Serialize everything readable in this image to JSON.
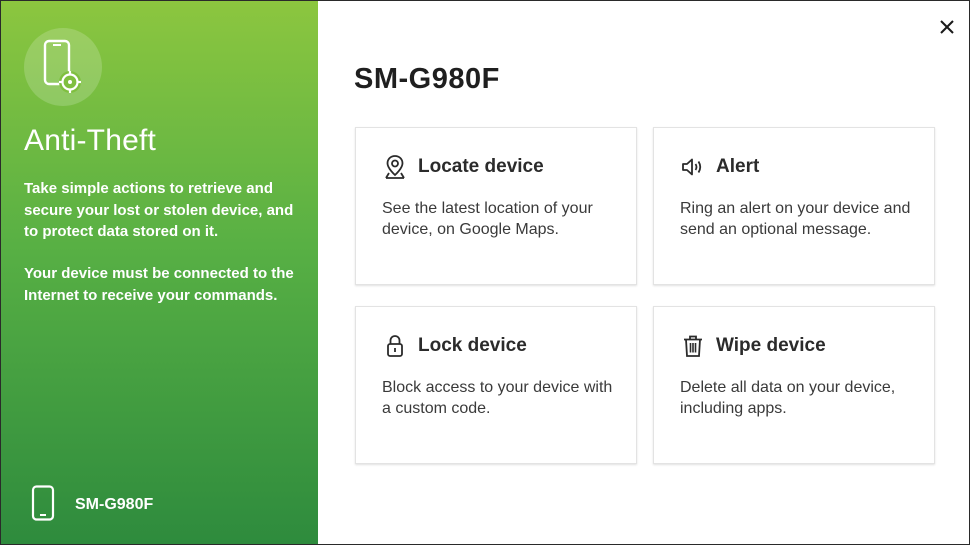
{
  "sidebar": {
    "title": "Anti-Theft",
    "paragraph1": "Take simple actions to retrieve and secure your lost or stolen device, and to protect data stored on it.",
    "paragraph2": "Your device must be connected to the Internet to receive your commands.",
    "device_label": "SM-G980F",
    "hero_icon": "phone-locate-icon",
    "footer_icon": "phone-icon",
    "gradient_top": "#8cc63f",
    "gradient_bottom": "#2e8b3d"
  },
  "main": {
    "title": "SM-G980F",
    "close_icon": "close-icon",
    "cards": [
      {
        "icon": "location-pin-icon",
        "title": "Locate device",
        "description": "See the latest location of your device, on Google Maps."
      },
      {
        "icon": "speaker-icon",
        "title": "Alert",
        "description": "Ring an alert on your device and send an optional message."
      },
      {
        "icon": "lock-icon",
        "title": "Lock device",
        "description": "Block access to your device with a custom code."
      },
      {
        "icon": "trash-icon",
        "title": "Wipe device",
        "description": "Delete all data on your device, including apps."
      }
    ]
  }
}
